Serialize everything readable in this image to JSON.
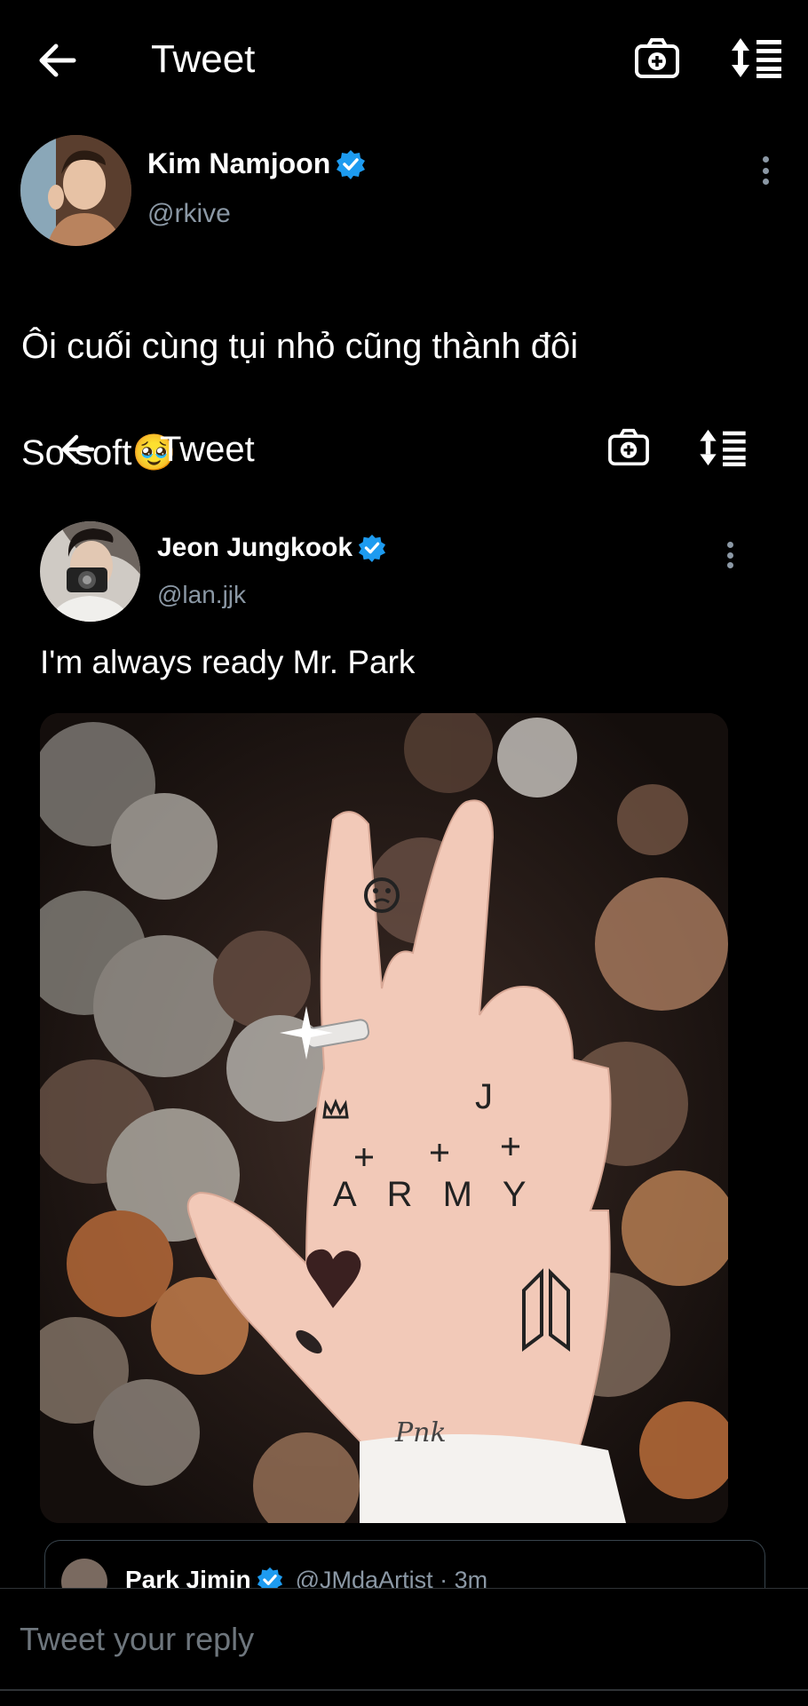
{
  "outer_header": {
    "title": "Tweet",
    "back_icon": "arrow-left-icon",
    "camera_icon": "camera-plus-icon",
    "sort_icon": "sort-list-icon"
  },
  "outer_tweet": {
    "author_name": "Kim Namjoon",
    "handle": "@rkive",
    "verified_icon": "verified-badge-icon",
    "text_line1": "Ôi cuối cùng tụi nhỏ cũng thành đôi",
    "text_line2": "So soft",
    "emoji": "🥹"
  },
  "embedded_header": {
    "title": "Tweet"
  },
  "embedded_tweet": {
    "author_name": "Jeon Jungkook",
    "handle": "@lan.jjk",
    "text": "I'm always ready Mr. Park",
    "hand_markings": {
      "letter_j": "J",
      "word_army": "ARMY",
      "wrist_text": "Pnk"
    }
  },
  "quoted_tweet": {
    "author_name": "Park Jimin",
    "handle_time": "@JMdaArtist · 3m"
  },
  "reply": {
    "placeholder": "Tweet your reply"
  },
  "colors": {
    "background": "#000000",
    "verified": "#1d9bf0",
    "secondary_text": "#8b98a5"
  }
}
